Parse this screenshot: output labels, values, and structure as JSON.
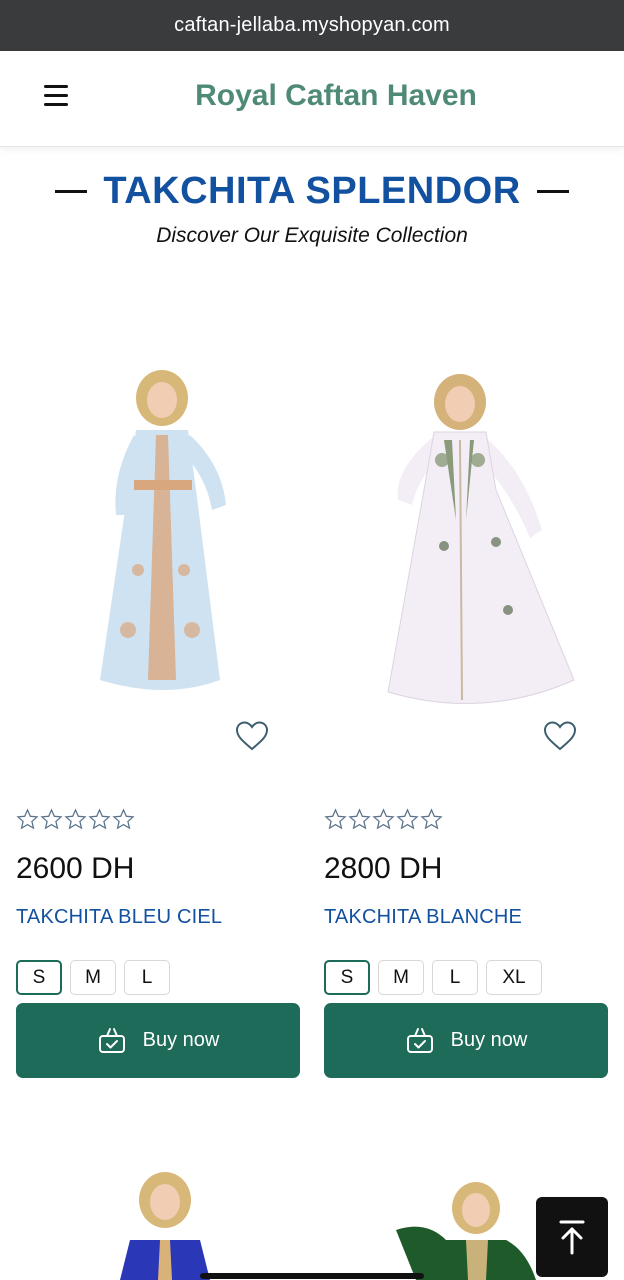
{
  "browser": {
    "url": "caftan-jellaba.myshopyan.com"
  },
  "header": {
    "brand": "Royal Caftan Haven",
    "menu_icon": "hamburger-icon"
  },
  "section": {
    "title": "TAKCHITA SPLENDOR",
    "subtitle": "Discover Our Exquisite Collection"
  },
  "products": [
    {
      "name": "TAKCHITA BLEU CIEL",
      "price": "2600 DH",
      "rating": 0,
      "sizes": [
        "S",
        "M",
        "L"
      ],
      "selected_size": "S",
      "buy_label": "Buy now",
      "dress_color": "#cfe2f2",
      "embroidery_color": "#d9a77e"
    },
    {
      "name": "TAKCHITA BLANCHE",
      "price": "2800 DH",
      "rating": 0,
      "sizes": [
        "S",
        "M",
        "L",
        "XL"
      ],
      "selected_size": "S",
      "buy_label": "Buy now",
      "dress_color": "#f3eef6",
      "embroidery_color": "#8a9a7a"
    }
  ],
  "colors": {
    "brand": "#4f8a77",
    "title_blue": "#1250a0",
    "button_green": "#1d6b58"
  },
  "icons": {
    "heart": "heart-icon",
    "star": "star-icon",
    "basket": "basket-icon",
    "back_to_top": "arrow-up-icon"
  }
}
